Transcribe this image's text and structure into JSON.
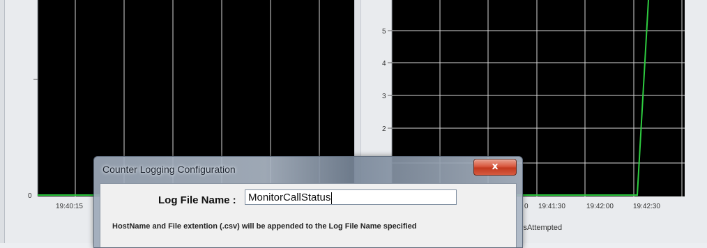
{
  "left_chart": {
    "y_ticks": [
      "0"
    ],
    "x_ticks": [
      "19:40:15"
    ]
  },
  "right_chart": {
    "y_ticks": [
      "2",
      "3",
      "4",
      "5"
    ],
    "x_ticks": [
      "0",
      "19:41:30",
      "19:42:00",
      "19:42:30"
    ],
    "legend_fragment": "lsAttempted",
    "series_color": "#2ecc40"
  },
  "dialog": {
    "title": "Counter Logging Configuration",
    "close_label": "x",
    "log_file_label": "Log File Name :",
    "log_file_value": "MonitorCallStatus",
    "hint": "HostName and File extention (.csv) will be appended to the Log File Name specified"
  }
}
